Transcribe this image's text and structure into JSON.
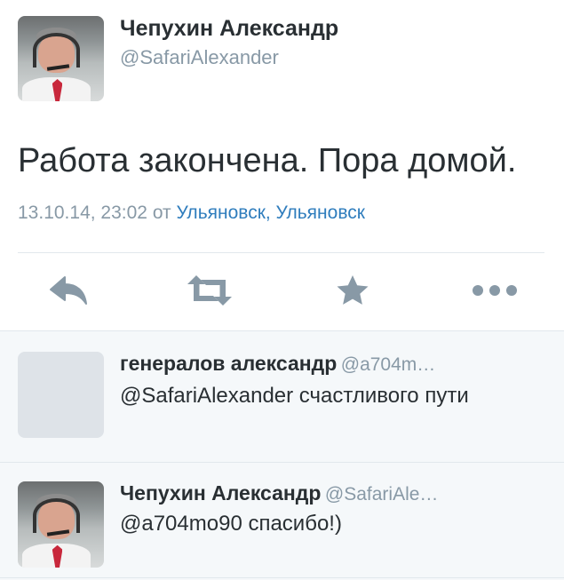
{
  "tweet": {
    "author_name": "Чепухин Александр",
    "author_handle": "@SafariAlexander",
    "text": "Работа закончена. Пора домой.",
    "timestamp": "13.10.14, 23:02",
    "from_word": "от",
    "location": "Ульяновск, Ульяновск"
  },
  "actions": [
    {
      "name": "reply",
      "icon": "reply-icon"
    },
    {
      "name": "retweet",
      "icon": "retweet-icon"
    },
    {
      "name": "favorite",
      "icon": "star-icon"
    },
    {
      "name": "more",
      "icon": "more-icon"
    }
  ],
  "replies": [
    {
      "author_name": "генералов александр",
      "author_handle": "@a704m…",
      "text": "@SafariAlexander счастливого пути"
    },
    {
      "author_name": "Чепухин Александр",
      "author_handle": "@SafariAle…",
      "text": "@a704mo90 спасибо!)"
    }
  ],
  "colors": {
    "text_primary": "#292f33",
    "text_secondary": "#8899a6",
    "link": "#2f7dbd",
    "icon": "#8899a6",
    "reply_background": "#f5f8fa",
    "divider": "#e1e8ed"
  }
}
